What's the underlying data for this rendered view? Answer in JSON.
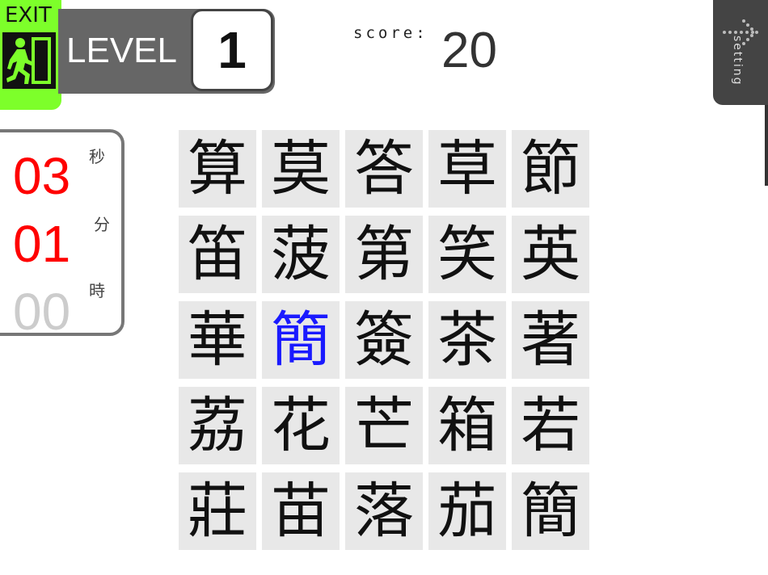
{
  "exit": {
    "label": "EXIT"
  },
  "level": {
    "label": "LEVEL",
    "value": "1"
  },
  "score": {
    "label": "score:",
    "value": "20"
  },
  "setting": {
    "label": "setting"
  },
  "timer": {
    "seconds": "03",
    "minutes": "01",
    "hours": "00",
    "seconds_unit": "秒",
    "minutes_unit": "分",
    "hours_unit": "時"
  },
  "grid": {
    "highlight_color": "#1a1aff",
    "rows": [
      [
        {
          "char": "算"
        },
        {
          "char": "莫"
        },
        {
          "char": "答"
        },
        {
          "char": "草"
        },
        {
          "char": "節"
        }
      ],
      [
        {
          "char": "笛"
        },
        {
          "char": "菠"
        },
        {
          "char": "第"
        },
        {
          "char": "笑"
        },
        {
          "char": "英"
        }
      ],
      [
        {
          "char": "華"
        },
        {
          "char": "簡",
          "highlight": true
        },
        {
          "char": "簽"
        },
        {
          "char": "茶"
        },
        {
          "char": "著"
        }
      ],
      [
        {
          "char": "荔"
        },
        {
          "char": "花"
        },
        {
          "char": "芒"
        },
        {
          "char": "箱"
        },
        {
          "char": "若"
        }
      ],
      [
        {
          "char": "莊"
        },
        {
          "char": "苗"
        },
        {
          "char": "落"
        },
        {
          "char": "茄"
        },
        {
          "char": "簡"
        }
      ]
    ]
  }
}
